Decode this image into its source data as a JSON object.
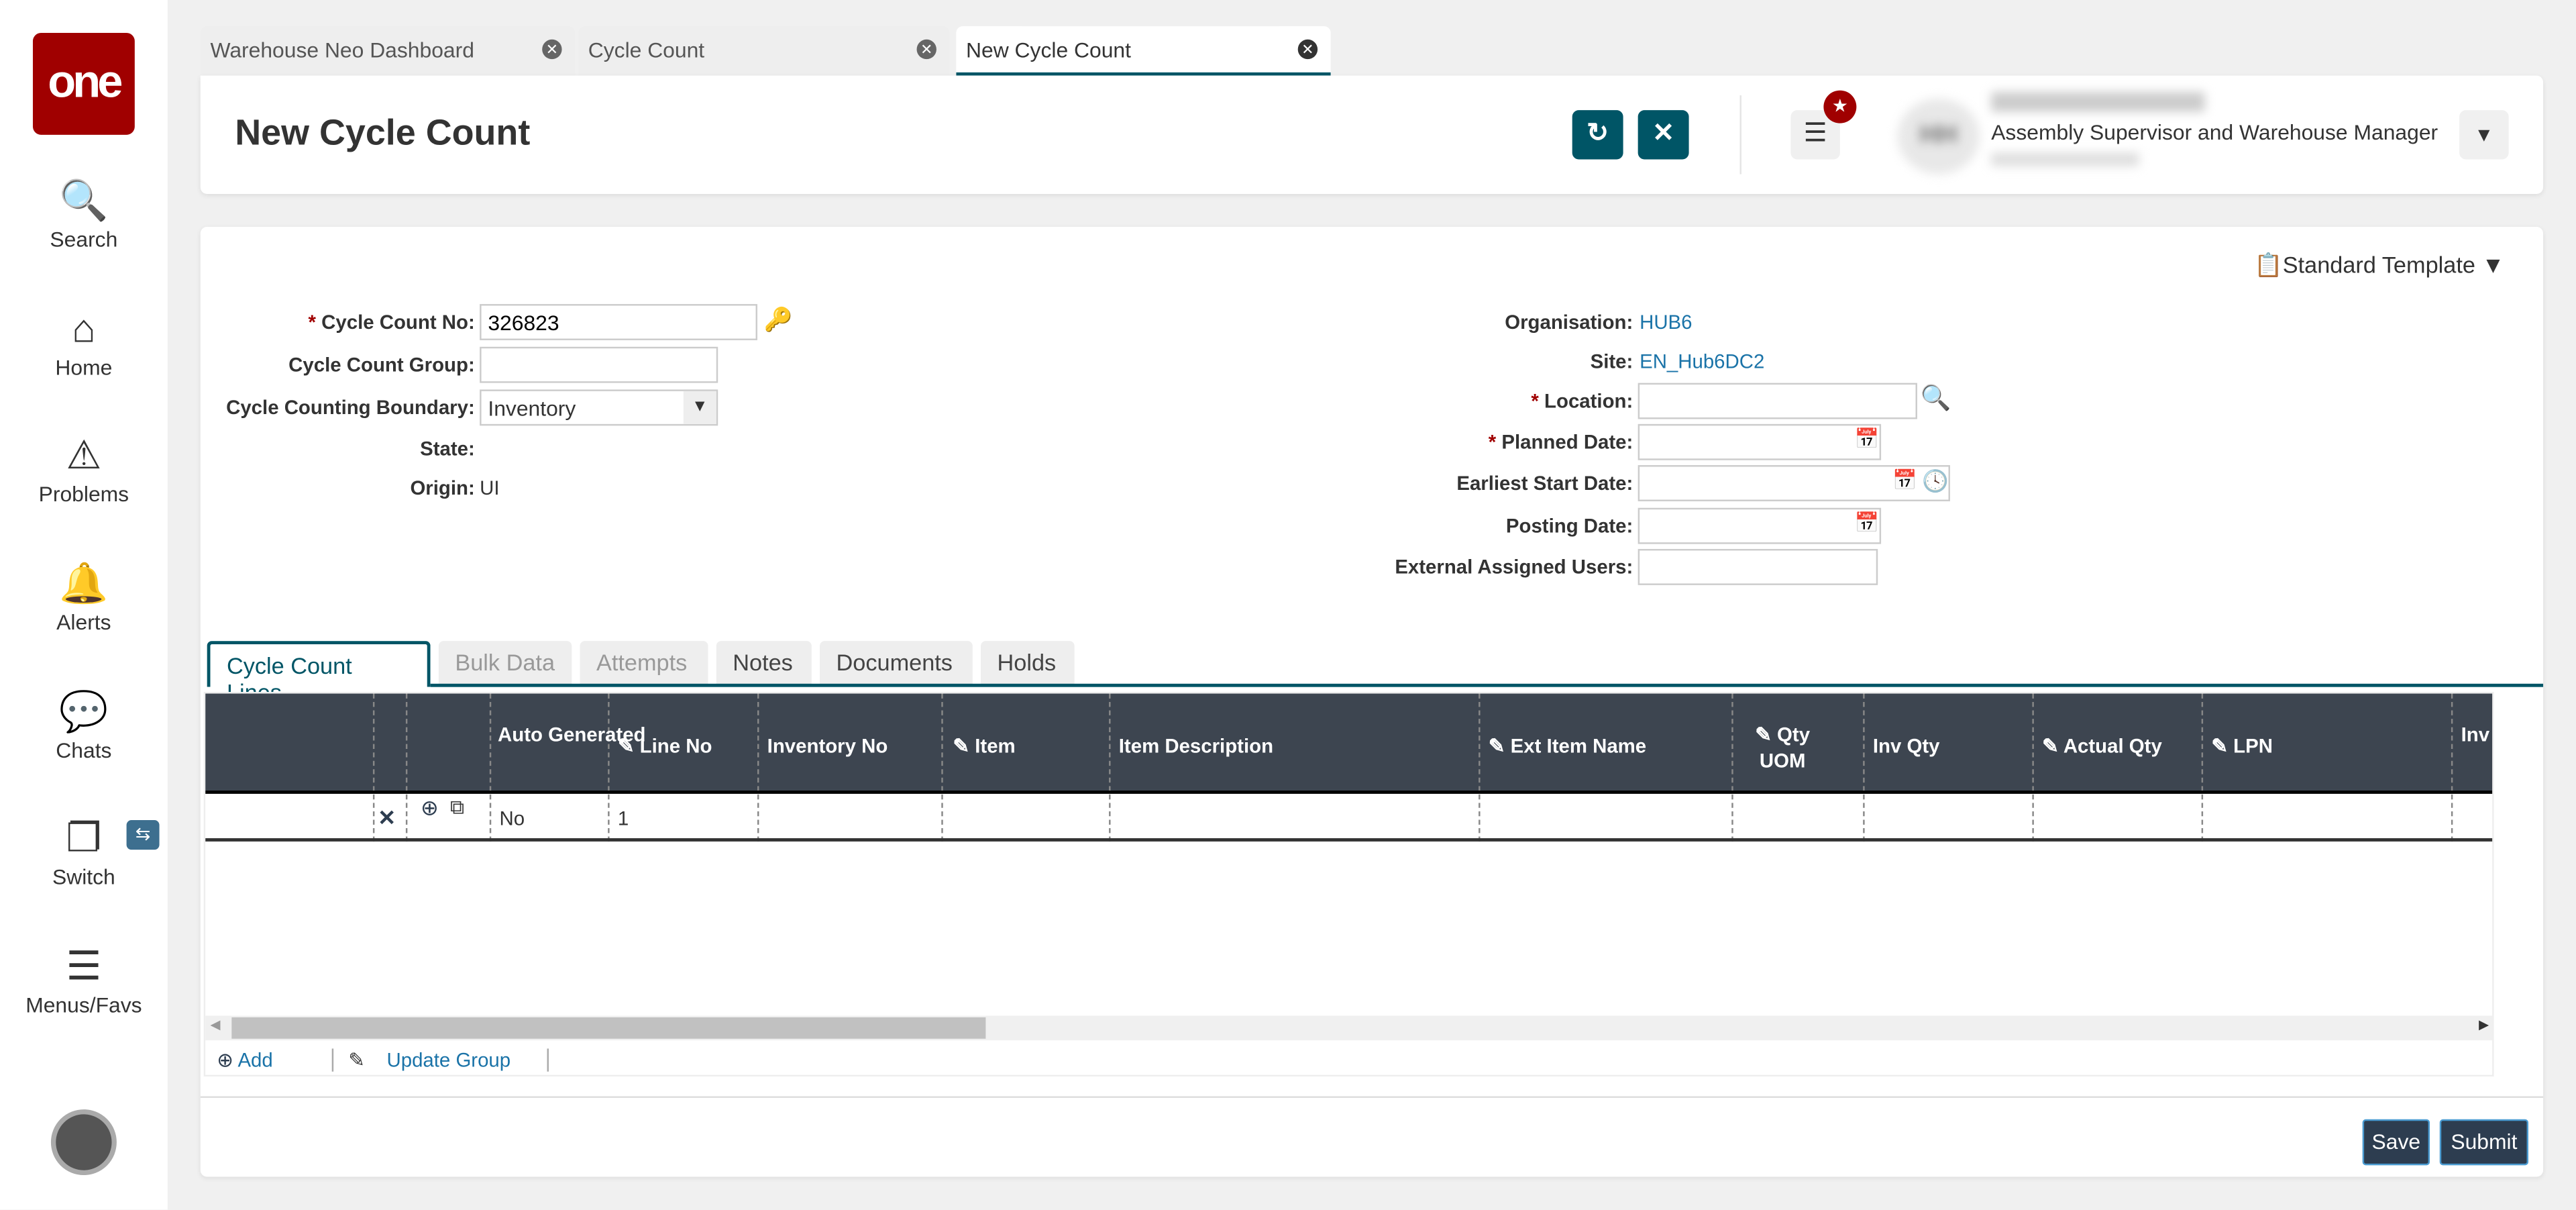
{
  "sidebar": {
    "logo": "one",
    "items": [
      {
        "label": "Search",
        "icon": "search-icon"
      },
      {
        "label": "Home",
        "icon": "home-icon"
      },
      {
        "label": "Problems",
        "icon": "warning-icon"
      },
      {
        "label": "Alerts",
        "icon": "bell-icon"
      },
      {
        "label": "Chats",
        "icon": "chat-icon"
      },
      {
        "label": "Switch",
        "icon": "switch-icon"
      },
      {
        "label": "Menus/Favs",
        "icon": "menu-icon"
      }
    ]
  },
  "tabs": [
    {
      "label": "Warehouse Neo Dashboard"
    },
    {
      "label": "Cycle Count"
    },
    {
      "label": "New Cycle Count",
      "active": true
    }
  ],
  "header": {
    "title": "New Cycle Count",
    "user_role": "Assembly Supervisor and Warehouse Manager",
    "user_initials": "HH"
  },
  "template": {
    "label": "Standard Template"
  },
  "form_left": {
    "cycle_count_no_label": "Cycle Count No:",
    "cycle_count_no": "326823",
    "group_label": "Cycle Count Group:",
    "group": "",
    "boundary_label": "Cycle Counting Boundary:",
    "boundary": "Inventory",
    "state_label": "State:",
    "state": "",
    "origin_label": "Origin:",
    "origin": "UI"
  },
  "form_right": {
    "organisation_label": "Organisation:",
    "organisation": "HUB6",
    "site_label": "Site:",
    "site": "EN_Hub6DC2",
    "location_label": "Location:",
    "planned_label": "Planned Date:",
    "earliest_label": "Earliest Start Date:",
    "posting_label": "Posting Date:",
    "external_label": "External Assigned Users:"
  },
  "subtabs": [
    {
      "label": "Cycle Count Lines"
    },
    {
      "label": "Bulk Data"
    },
    {
      "label": "Attempts"
    },
    {
      "label": "Notes"
    },
    {
      "label": "Documents"
    },
    {
      "label": "Holds"
    }
  ],
  "grid": {
    "columns": [
      "Auto Generated",
      "Line No",
      "Inventory No",
      "Item",
      "Item Description",
      "Ext Item Name",
      "Qty UOM",
      "Inv Qty",
      "Actual Qty",
      "LPN",
      "Inv Pack"
    ],
    "rows": [
      {
        "auto_generated": "No",
        "line_no": "1"
      }
    ]
  },
  "footer": {
    "add": "Add",
    "update_group": "Update Group"
  },
  "actions": {
    "save": "Save",
    "submit": "Submit"
  },
  "colors": {
    "accent": "#005566",
    "brand": "#a00000",
    "grid_header": "#3d4550"
  }
}
